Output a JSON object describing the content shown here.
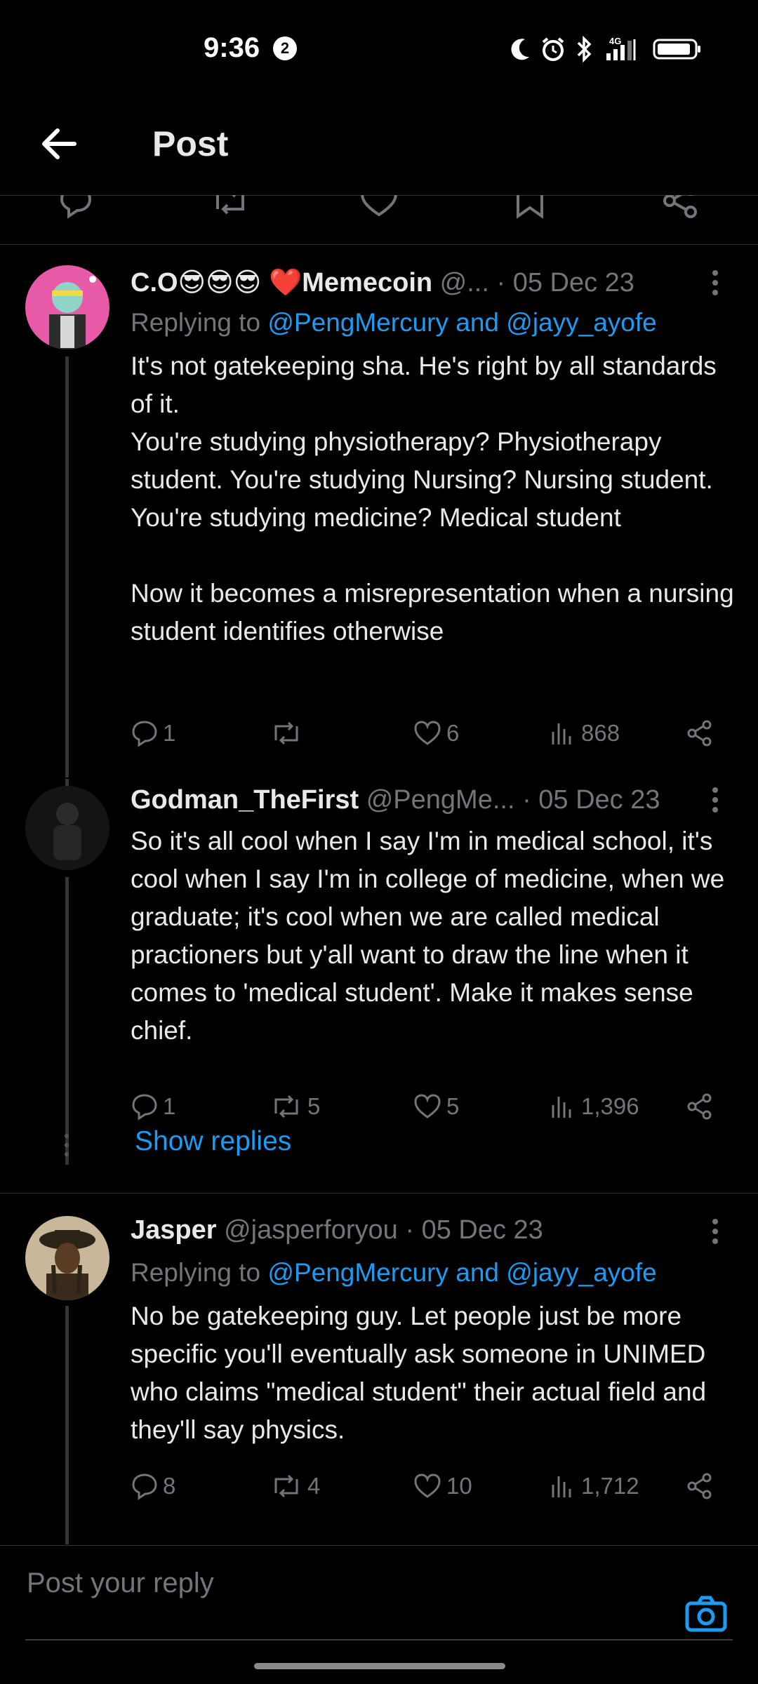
{
  "status_bar": {
    "time": "9:36",
    "notification_count": "2",
    "network": "4G"
  },
  "header": {
    "title": "Post"
  },
  "replies": [
    {
      "name": "C.O😎😎😎 ❤️Memecoin",
      "handle": "@...",
      "date": " · 05 Dec 23",
      "replying_prefix": "Replying to ",
      "replying_mentions": "@PengMercury and @jayy_ayofe",
      "text": "It's not gatekeeping sha. He's right by all standards of it.\nYou're studying physiotherapy? Physiotherapy student. You're studying Nursing? Nursing student.\nYou're studying medicine? Medical student\n\nNow it becomes a misrepresentation when a nursing student identifies otherwise",
      "replies_count": "1",
      "reposts_count": "",
      "likes_count": "6",
      "views_count": "868"
    },
    {
      "name": "Godman_TheFirst",
      "handle": "@PengMe...",
      "date": " · 05 Dec 23",
      "text": "So it's all cool when I say I'm in medical school, it's cool when I say I'm in college of medicine, when we graduate; it's cool when we are called medical practioners but y'all want to draw the line when it comes to 'medical student'. Make it makes sense chief.",
      "replies_count": "1",
      "reposts_count": "5",
      "likes_count": "5",
      "views_count": "1,396"
    },
    {
      "name": "Jasper",
      "handle": "@jasperforyou",
      "date": " · 05 Dec 23",
      "replying_prefix": "Replying to ",
      "replying_mentions": "@PengMercury and @jayy_ayofe",
      "text": "No be gatekeeping guy. Let people just be more specific you'll eventually ask someone in UNIMED who claims \"medical student\" their actual field and they'll say physics.",
      "replies_count": "8",
      "reposts_count": "4",
      "likes_count": "10",
      "views_count": "1,712"
    }
  ],
  "show_replies_label": "Show replies",
  "reply_bar": {
    "placeholder": "Post your reply"
  },
  "colors": {
    "background": "#000000",
    "text": "#e7e9ea",
    "muted": "#71767b",
    "accent": "#1d9bf0",
    "divider": "#2f3336"
  },
  "icons": {
    "back": "arrow-left-icon",
    "reply": "speech-bubble-icon",
    "repost": "repost-arrows-icon",
    "like": "heart-icon",
    "views": "bar-chart-icon",
    "share": "share-nodes-icon",
    "more": "vertical-dots-icon",
    "camera": "camera-icon"
  }
}
